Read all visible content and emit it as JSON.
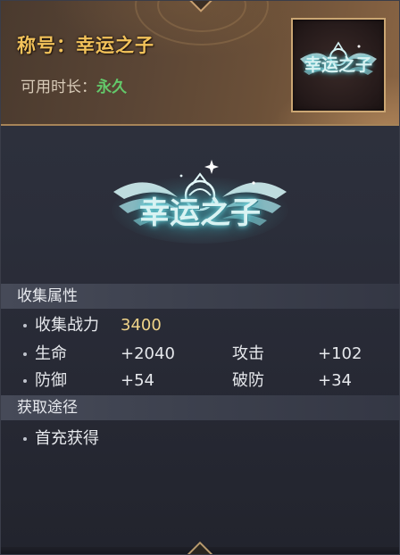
{
  "header": {
    "title_label": "称号：",
    "title_name": "幸运之子",
    "duration_label": "可用时长：",
    "duration_value": "永久"
  },
  "emblem": {
    "text": "幸运之子"
  },
  "attributes": {
    "section_title": "收集属性",
    "collect_power_label": "收集战力",
    "collect_power_value": "3400",
    "rows": [
      {
        "label1": "生命",
        "value1": "+2040",
        "label2": "攻击",
        "value2": "+102"
      },
      {
        "label1": "防御",
        "value1": "+54",
        "label2": "破防",
        "value2": "+34"
      }
    ]
  },
  "source": {
    "section_title": "获取途径",
    "items": [
      "首充获得"
    ]
  },
  "colors": {
    "title_gold": "#f2c25a",
    "duration_green": "#63c96a",
    "power_gold": "#efd389",
    "emblem_glow": "#7fe1e8"
  }
}
